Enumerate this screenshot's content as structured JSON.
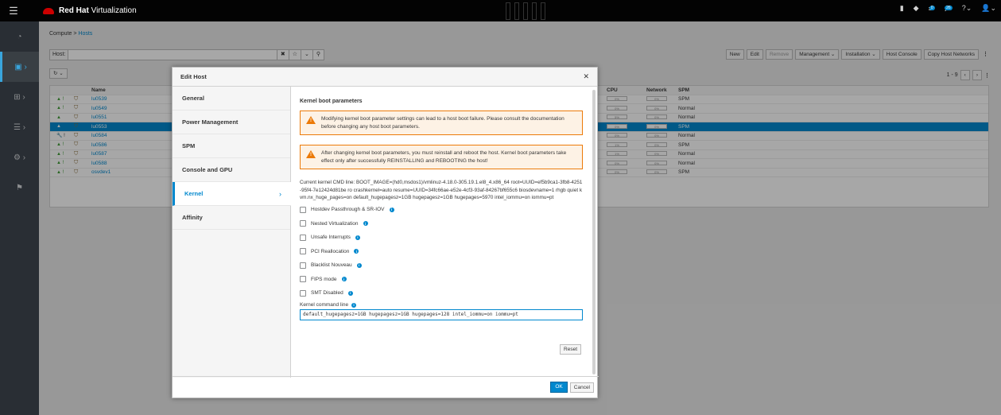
{
  "header": {
    "brand_bold": "Red Hat",
    "brand_rest": " Virtualization",
    "notification_badge": "0",
    "alert_badge": "26"
  },
  "breadcrumb": {
    "root": "Compute",
    "sep": ">",
    "current": "Hosts"
  },
  "search": {
    "label": "Host:",
    "value": ""
  },
  "actions": [
    "New",
    "Edit",
    "Remove",
    "Management ⌄",
    "Installation ⌄",
    "Host Console",
    "Copy Host Networks"
  ],
  "paging": {
    "range": "1 - 9"
  },
  "grid": {
    "columns": {
      "name": "Name",
      "cpu": "CPU",
      "network": "Network",
      "spm": "SPM"
    },
    "rows": [
      {
        "name": "lu0539",
        "cpu": "0%",
        "net": "0%",
        "spm": "SPM"
      },
      {
        "name": "lu0549",
        "cpu": "0%",
        "net": "0%",
        "spm": "Normal"
      },
      {
        "name": "lu0551",
        "cpu": "5%",
        "net": "0%",
        "spm": "Normal"
      },
      {
        "name": "lu0553",
        "cpu": "0%",
        "net": "0%",
        "spm": "SPM"
      },
      {
        "name": "lu0584",
        "cpu": "0%",
        "net": "0%",
        "spm": "Normal"
      },
      {
        "name": "lu0586",
        "cpu": "1%",
        "net": "0%",
        "spm": "SPM"
      },
      {
        "name": "lu0587",
        "cpu": "1%",
        "net": "0%",
        "spm": "Normal"
      },
      {
        "name": "lu0588",
        "cpu": "0%",
        "net": "0%",
        "spm": "Normal"
      },
      {
        "name": "osvdev1",
        "cpu": "0%",
        "net": "0%",
        "spm": "SPM"
      }
    ]
  },
  "modal": {
    "title": "Edit Host",
    "tabs": [
      "General",
      "Power Management",
      "SPM",
      "Console and GPU",
      "Kernel",
      "Affinity"
    ],
    "section_title": "Kernel boot parameters",
    "alert1": "Modifying kernel boot parameter settings can lead to a host boot failure. Please consult the documentation before changing any host boot parameters.",
    "alert2": "After changing kernel boot parameters, you must reinstall and reboot the host. Kernel boot parameters take effect only after successfully REINSTALLING and REBOOTING the host!",
    "current_cmd": "Current kernel CMD line: BOOT_IMAGE=(hd0,msdos1)/vmlinuz-4.18.0-305.19.1.el8_4.x86_64 root=UUID=ef5b9ca1-3fb8-4251-95f4-7e12424d81be ro crashkernel=auto resume=UUID=34fc66ae-e52e-4cf3-93af-84267bf655c6 biosdevname=1 rhgb quiet kvm.nx_huge_pages=on default_hugepagesz=1GB hugepagesz=1GB hugepages=5970 intel_iommu=on iommu=pt",
    "checkboxes": [
      "Hostdev Passthrough & SR-IOV",
      "Nested Virtualization",
      "Unsafe Interrupts",
      "PCI Reallocation",
      "Blacklist Nouveau",
      "FIPS mode",
      "SMT Disabled"
    ],
    "kcl_label": "Kernel command line",
    "kcl_value": "default_hugepagesz=1GB hugepagesz=1GB hugepages=128 intel_iommu=on iommu=pt",
    "reset": "Reset",
    "ok": "OK",
    "cancel": "Cancel"
  }
}
